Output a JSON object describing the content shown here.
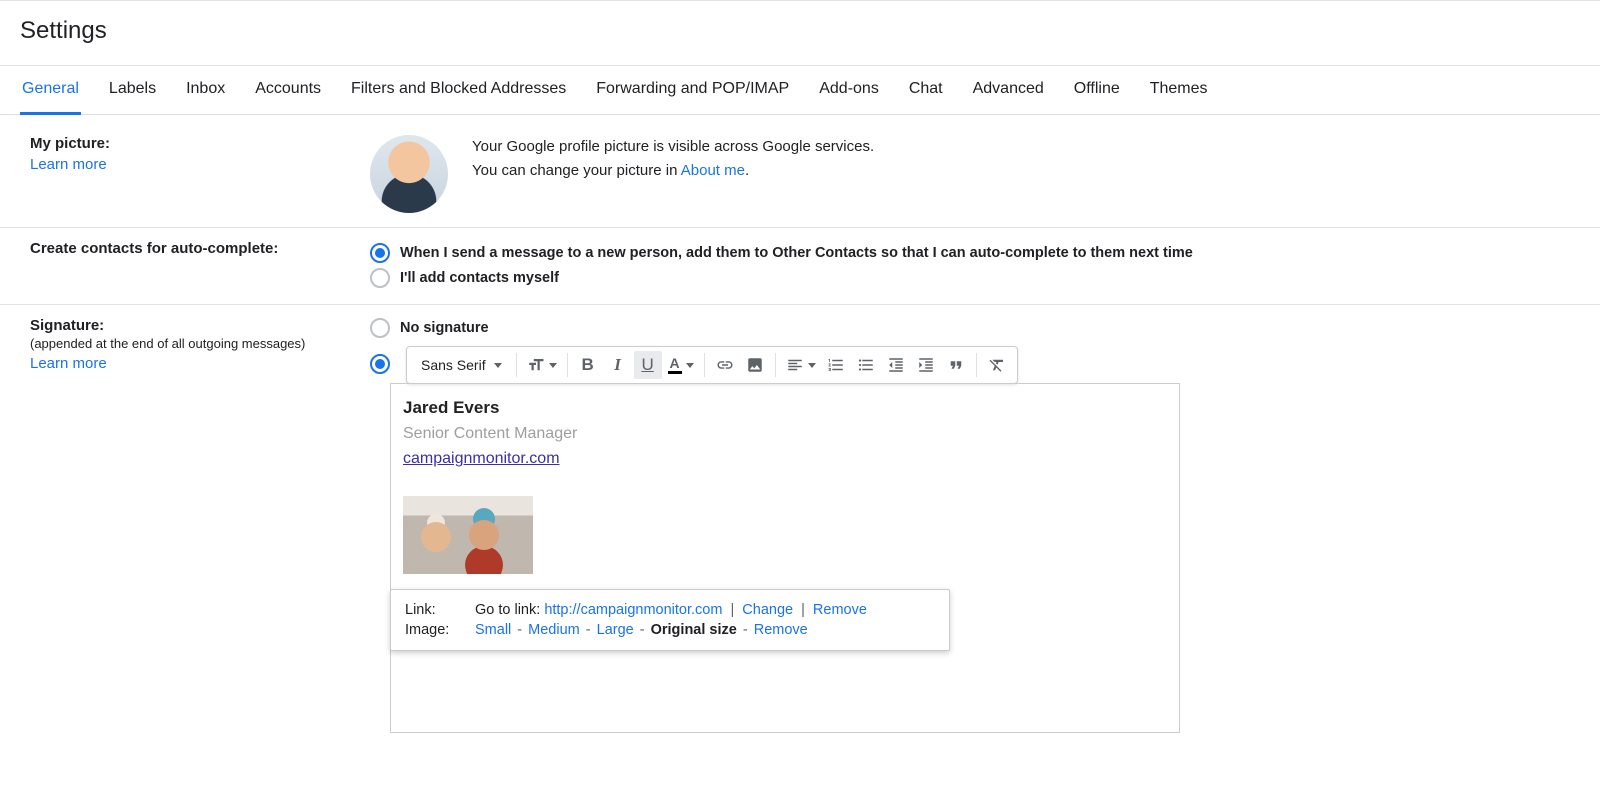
{
  "header": {
    "title": "Settings"
  },
  "tabs": [
    {
      "label": "General",
      "active": true
    },
    {
      "label": "Labels"
    },
    {
      "label": "Inbox"
    },
    {
      "label": "Accounts"
    },
    {
      "label": "Filters and Blocked Addresses"
    },
    {
      "label": "Forwarding and POP/IMAP"
    },
    {
      "label": "Add-ons"
    },
    {
      "label": "Chat"
    },
    {
      "label": "Advanced"
    },
    {
      "label": "Offline"
    },
    {
      "label": "Themes"
    }
  ],
  "links": {
    "learn_more": "Learn more",
    "about_me": "About me"
  },
  "my_picture": {
    "title": "My picture:",
    "desc1": "Your Google profile picture is visible across Google services.",
    "desc2_prefix": "You can change your picture in ",
    "desc2_suffix": "."
  },
  "contacts": {
    "title": "Create contacts for auto-complete:",
    "option1": "When I send a message to a new person, add them to Other Contacts so that I can auto-complete to them next time",
    "option2": "I'll add contacts myself",
    "selected": 0
  },
  "signature": {
    "title": "Signature:",
    "note": "(appended at the end of all outgoing messages)",
    "no_sig": "No signature",
    "selected": 1,
    "toolbar": {
      "font": "Sans Serif"
    },
    "content": {
      "name": "Jared Evers",
      "role": "Senior Content Manager",
      "link": "campaignmonitor.com"
    }
  },
  "popup": {
    "link_label": "Link:",
    "goto": "Go to link: ",
    "url": "http://campaignmonitor.com",
    "change": "Change",
    "remove": "Remove",
    "image_label": "Image:",
    "small": "Small",
    "medium": "Medium",
    "large": "Large",
    "original": "Original size"
  }
}
